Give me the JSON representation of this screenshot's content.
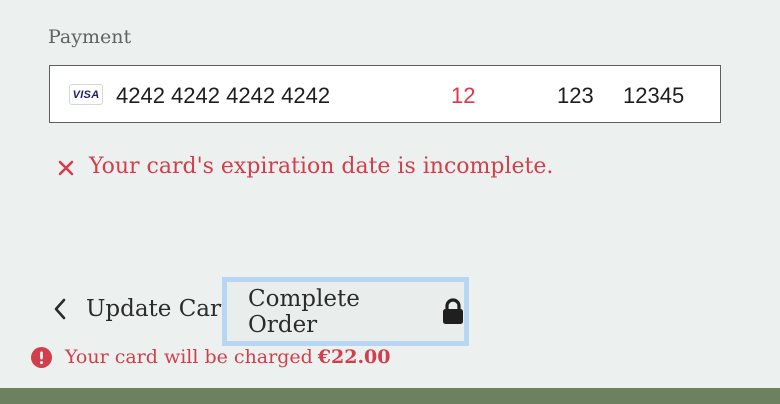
{
  "payment": {
    "label": "Payment",
    "card": {
      "brand": "VISA",
      "brand_icon": "visa-icon",
      "number": "4242 4242 4242 4242",
      "expiration": "12",
      "cvc": "123",
      "zip": "12345"
    },
    "error": {
      "icon": "x-icon",
      "message": "Your card's expiration date is incomplete."
    }
  },
  "actions": {
    "back_label": "Update Cart",
    "back_icon": "chevron-left-icon",
    "submit_label": "Complete Order",
    "submit_icon": "lock-icon"
  },
  "charge_notice": {
    "icon": "alert-circle-icon",
    "text": "Your card will be charged",
    "amount": "€22.00"
  },
  "colors": {
    "background": "#ecf1f0",
    "error": "#d23e4b",
    "focus_ring": "#b6d6f4",
    "footer": "#6b8160"
  }
}
